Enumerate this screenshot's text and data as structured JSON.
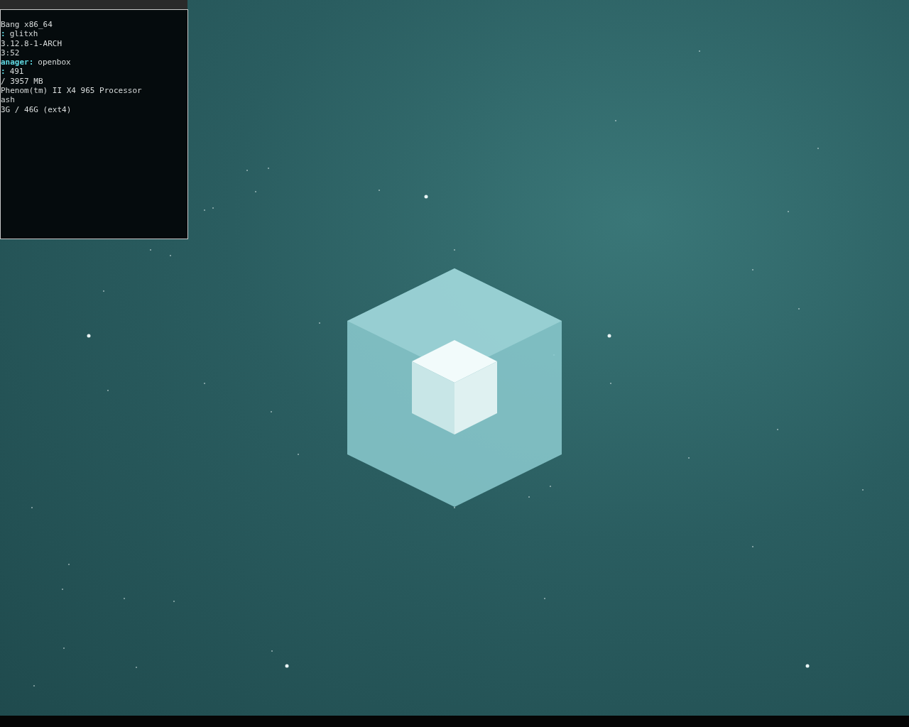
{
  "terminal": {
    "lines": [
      {
        "value": "Bang x86_64"
      },
      {
        "key": ":",
        "value": "glitxh"
      },
      {
        "value": "3.12.8-1-ARCH"
      },
      {
        "value": "3:52"
      },
      {
        "key": "anager:",
        "value": "openbox"
      },
      {
        "key": ":",
        "value": "491"
      },
      {
        "value": "/ 3957 MB"
      },
      {
        "value": "Phenom(tm) II X4 965 Processor"
      },
      {
        "value": "ash"
      },
      {
        "value": "3G / 46G (ext4)"
      }
    ]
  }
}
